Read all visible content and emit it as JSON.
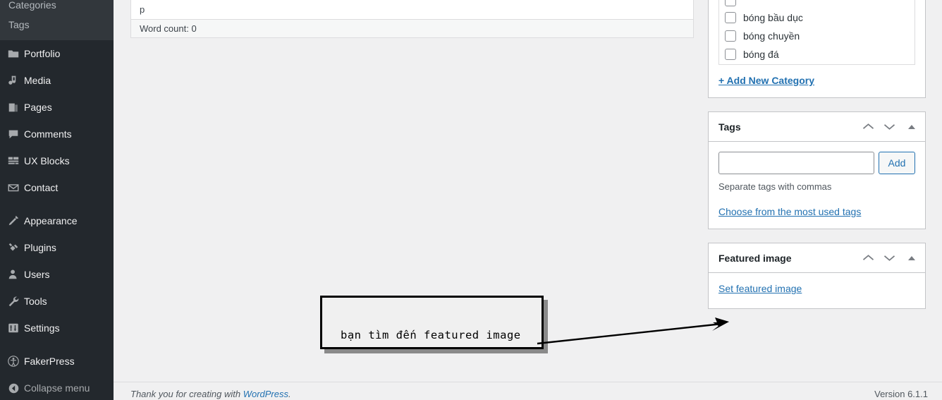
{
  "sidebar": {
    "submenu": [
      {
        "label": "Categories",
        "name": "submenu-item-categories"
      },
      {
        "label": "Tags",
        "name": "submenu-item-tags"
      }
    ],
    "items": [
      {
        "label": "Portfolio",
        "icon": "portfolio-icon"
      },
      {
        "label": "Media",
        "icon": "media-icon"
      },
      {
        "label": "Pages",
        "icon": "pages-icon"
      },
      {
        "label": "Comments",
        "icon": "comments-icon"
      },
      {
        "label": "UX Blocks",
        "icon": "ux-blocks-icon"
      },
      {
        "label": "Contact",
        "icon": "contact-icon"
      },
      {
        "label": "Appearance",
        "icon": "appearance-icon"
      },
      {
        "label": "Plugins",
        "icon": "plugins-icon"
      },
      {
        "label": "Users",
        "icon": "users-icon"
      },
      {
        "label": "Tools",
        "icon": "tools-icon"
      },
      {
        "label": "Settings",
        "icon": "settings-icon"
      },
      {
        "label": "FakerPress",
        "icon": "fakerpress-icon"
      }
    ],
    "collapse_label": "Collapse menu"
  },
  "editor": {
    "path_element": "p",
    "word_count": "Word count: 0"
  },
  "categories_panel": {
    "items": [
      {
        "label": "",
        "checked": false,
        "partial": true
      },
      {
        "label": "bóng bầu dục",
        "checked": false
      },
      {
        "label": "bóng chuyền",
        "checked": false
      },
      {
        "label": "bóng đá",
        "checked": false
      }
    ],
    "add_new_label": "+ Add New Category"
  },
  "tags_panel": {
    "title": "Tags",
    "input_value": "",
    "input_placeholder": "",
    "add_label": "Add",
    "help_text": "Separate tags with commas",
    "choose_link": "Choose from the most used tags"
  },
  "featured_image_panel": {
    "title": "Featured image",
    "set_link": "Set featured image"
  },
  "footer": {
    "thanks_prefix": "Thank you for creating with ",
    "wordpress_link": "WordPress",
    "thanks_suffix": ".",
    "version": "Version 6.1.1"
  },
  "annotation": {
    "text": "bạn tìm đến featured image"
  },
  "colors": {
    "admin_menu_bg": "#23282d",
    "submenu_bg": "#32373c",
    "content_bg": "#f0f0f1",
    "link_blue": "#2271b1",
    "panel_border": "#c3c4c7"
  }
}
